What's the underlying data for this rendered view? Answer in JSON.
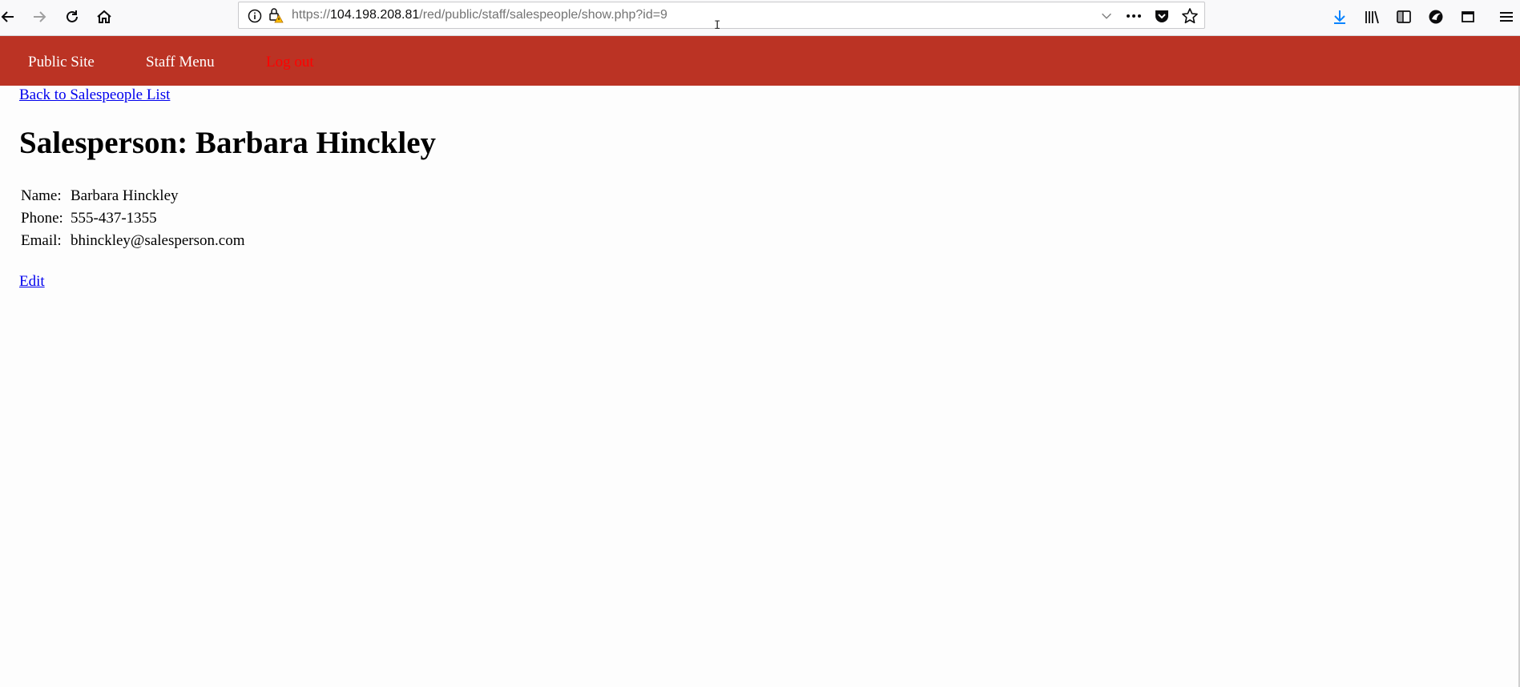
{
  "browser": {
    "url_scheme": "https://",
    "url_host": "104.198.208.81",
    "url_path": "/red/public/staff/salespeople/show.php?id=9",
    "icons": {
      "back": "back-arrow-icon",
      "forward": "forward-arrow-icon",
      "reload": "reload-icon",
      "home": "home-icon",
      "info": "info-icon",
      "insecure_lock": "insecure-lock-icon",
      "dropdown": "chevron-down-icon",
      "page_actions": "more-icon",
      "pocket": "pocket-icon",
      "bookmark": "star-icon",
      "downloads": "download-icon",
      "library": "library-icon",
      "sidebar": "sidebar-icon",
      "account": "account-icon",
      "window": "window-icon",
      "menu": "hamburger-menu-icon"
    },
    "accent_download": "#0a84ff"
  },
  "nav": {
    "background": "#bb3324",
    "items": [
      {
        "label": "Public Site"
      },
      {
        "label": "Staff Menu"
      },
      {
        "label": "Log out"
      }
    ]
  },
  "page": {
    "back_link": "Back to Salespeople List",
    "title": "Salesperson: Barbara Hinckley",
    "attributes": [
      {
        "label": "Name:",
        "value": "Barbara Hinckley"
      },
      {
        "label": "Phone:",
        "value": "555-437-1355"
      },
      {
        "label": "Email:",
        "value": "bhinckley@salesperson.com"
      }
    ],
    "edit_link": "Edit"
  }
}
